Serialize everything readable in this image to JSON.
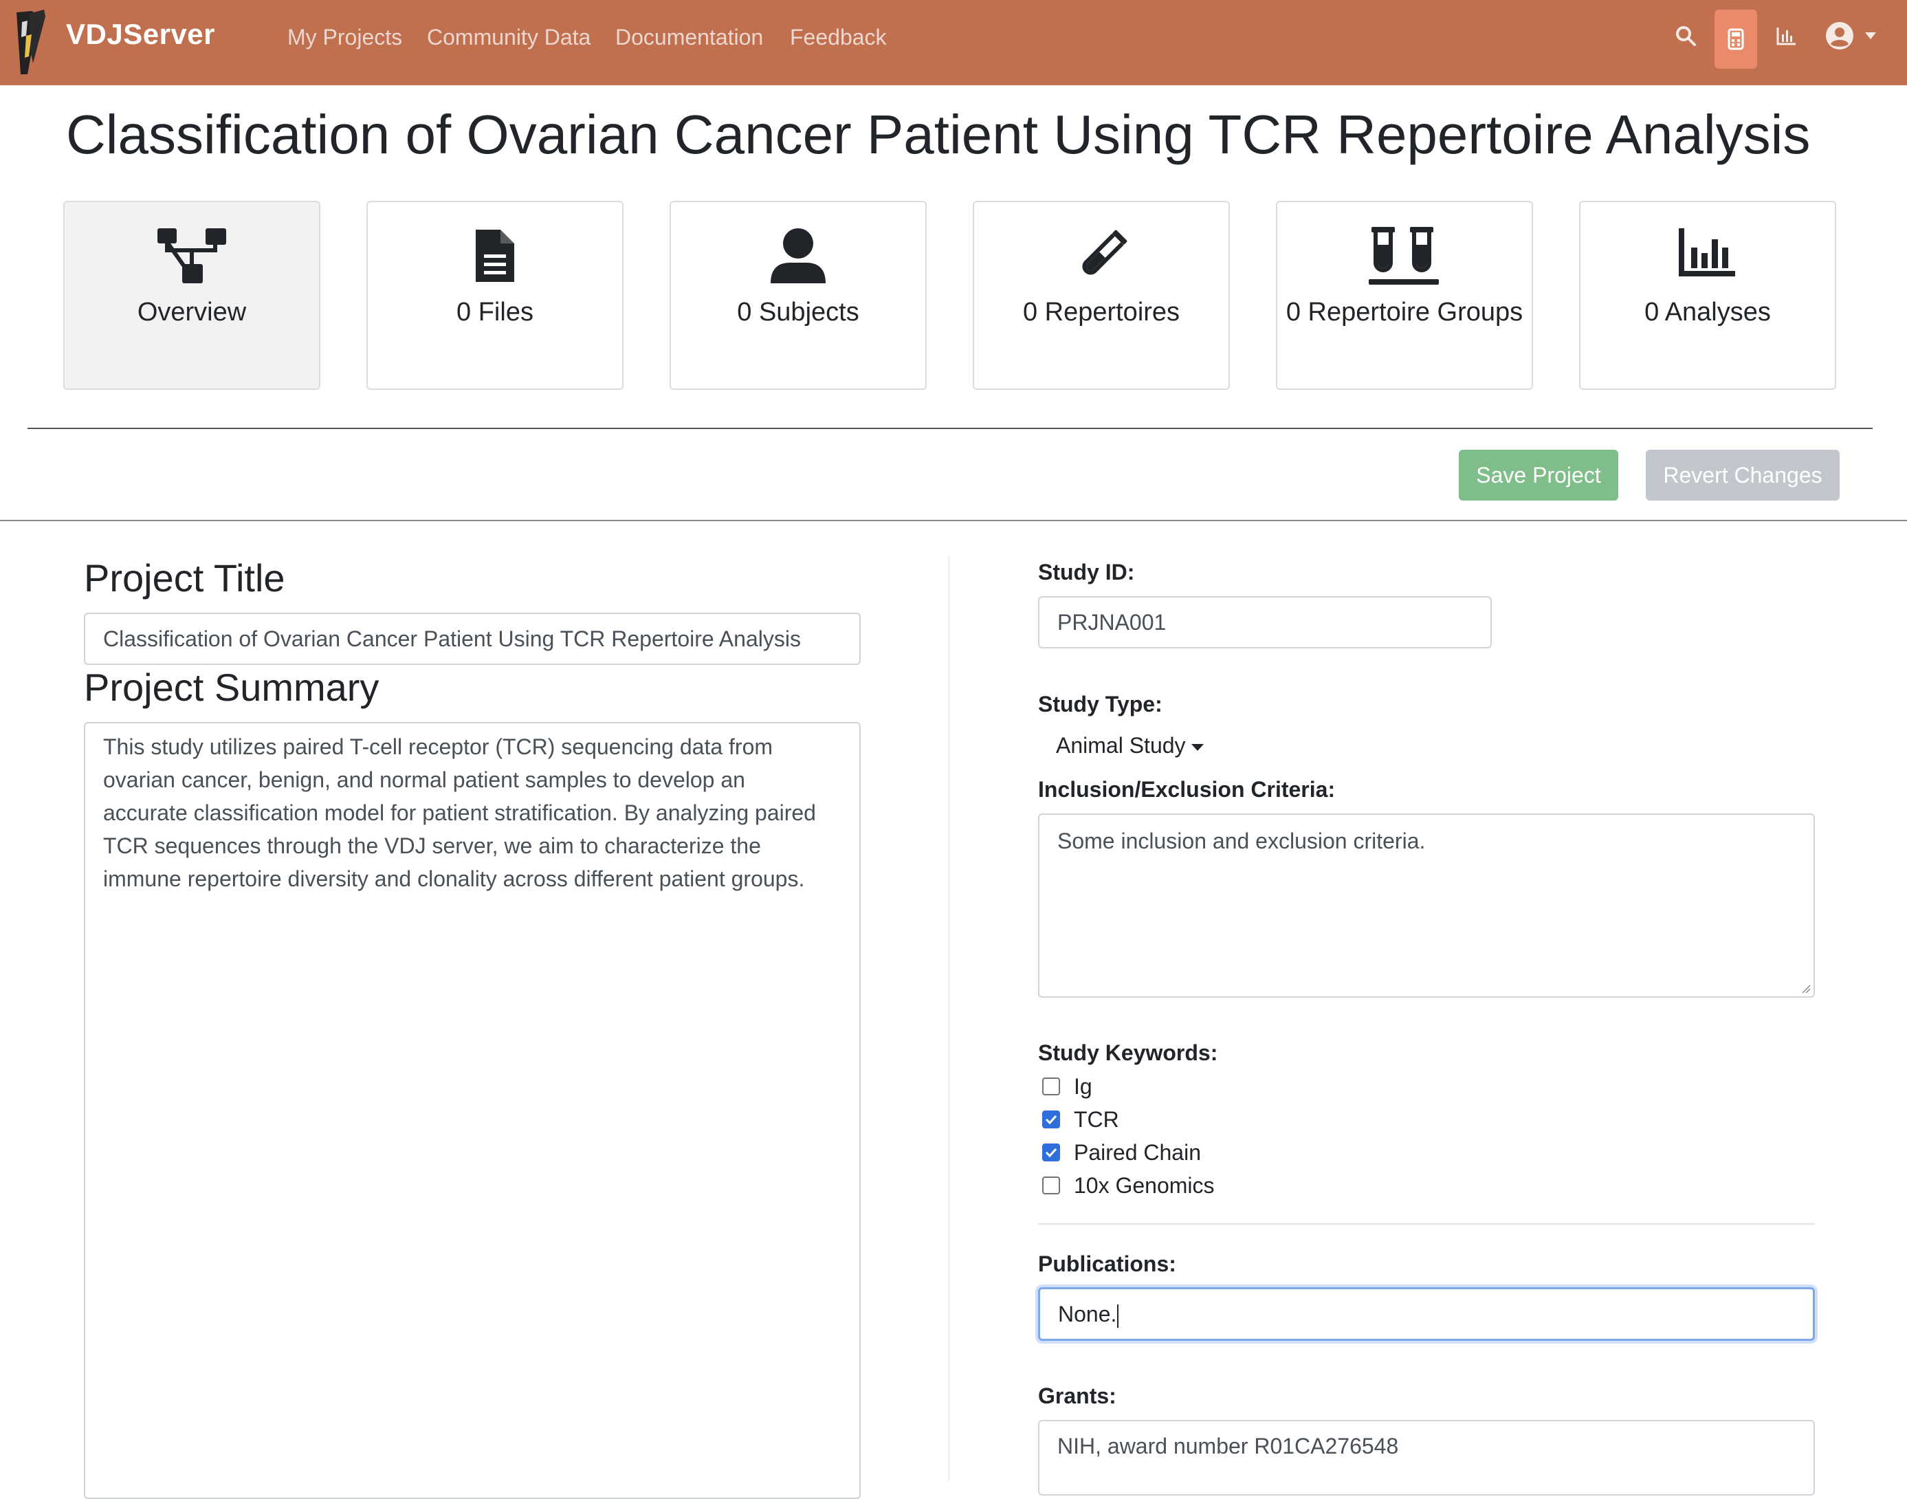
{
  "navbar": {
    "brand": "VDJServer",
    "links": [
      "My Projects",
      "Community Data",
      "Documentation",
      "Feedback"
    ],
    "icons": [
      "search-icon",
      "calculator-icon",
      "chart-bar-icon",
      "user-circle-icon",
      "caret-down-icon"
    ],
    "background_color": "#c0704f",
    "active_icon_color": "#e98a6a"
  },
  "page": {
    "title": "Classification of Ovarian Cancer Patient Using TCR Repertoire Analysis"
  },
  "tabs": [
    {
      "label": "Overview",
      "icon": "sitemap-icon",
      "active": true
    },
    {
      "label": "0 Files",
      "icon": "file-icon",
      "active": false
    },
    {
      "label": "0 Subjects",
      "icon": "user-icon",
      "active": false
    },
    {
      "label": "0 Repertoires",
      "icon": "vial-icon",
      "active": false
    },
    {
      "label": "0 Repertoire Groups",
      "icon": "vials-icon",
      "active": false
    },
    {
      "label": "0 Analyses",
      "icon": "chart-bar-icon",
      "active": false
    }
  ],
  "actions": {
    "save_label": "Save Project",
    "revert_label": "Revert Changes",
    "save_color": "#7fbd8a",
    "revert_color": "#c2c7cd"
  },
  "left": {
    "title_heading": "Project Title",
    "title_value": "Classification of Ovarian Cancer Patient Using TCR Repertoire Analysis",
    "summary_heading": "Project Summary",
    "summary_lines": [
      "This study utilizes paired T-cell receptor (TCR) sequencing data from",
      "ovarian cancer, benign, and normal patient samples to develop an",
      "accurate classification model for patient stratification. By analyzing paired",
      "TCR sequences through the VDJ server, we aim to characterize the",
      "immune repertoire diversity and clonality across different patient groups."
    ]
  },
  "right": {
    "study_id_label": "Study ID:",
    "study_id_value": "PRJNA001",
    "study_type_label": "Study Type:",
    "study_type_value": "Animal Study",
    "criteria_label": "Inclusion/Exclusion Criteria:",
    "criteria_value": "Some inclusion and exclusion criteria.",
    "keywords_label": "Study Keywords:",
    "keywords": [
      {
        "label": "Ig",
        "checked": false
      },
      {
        "label": "TCR",
        "checked": true
      },
      {
        "label": "Paired Chain",
        "checked": true
      },
      {
        "label": "10x Genomics",
        "checked": false
      }
    ],
    "publications_label": "Publications:",
    "publications_value": "None.",
    "grants_label": "Grants:",
    "grants_value": "NIH, award number R01CA276548"
  }
}
